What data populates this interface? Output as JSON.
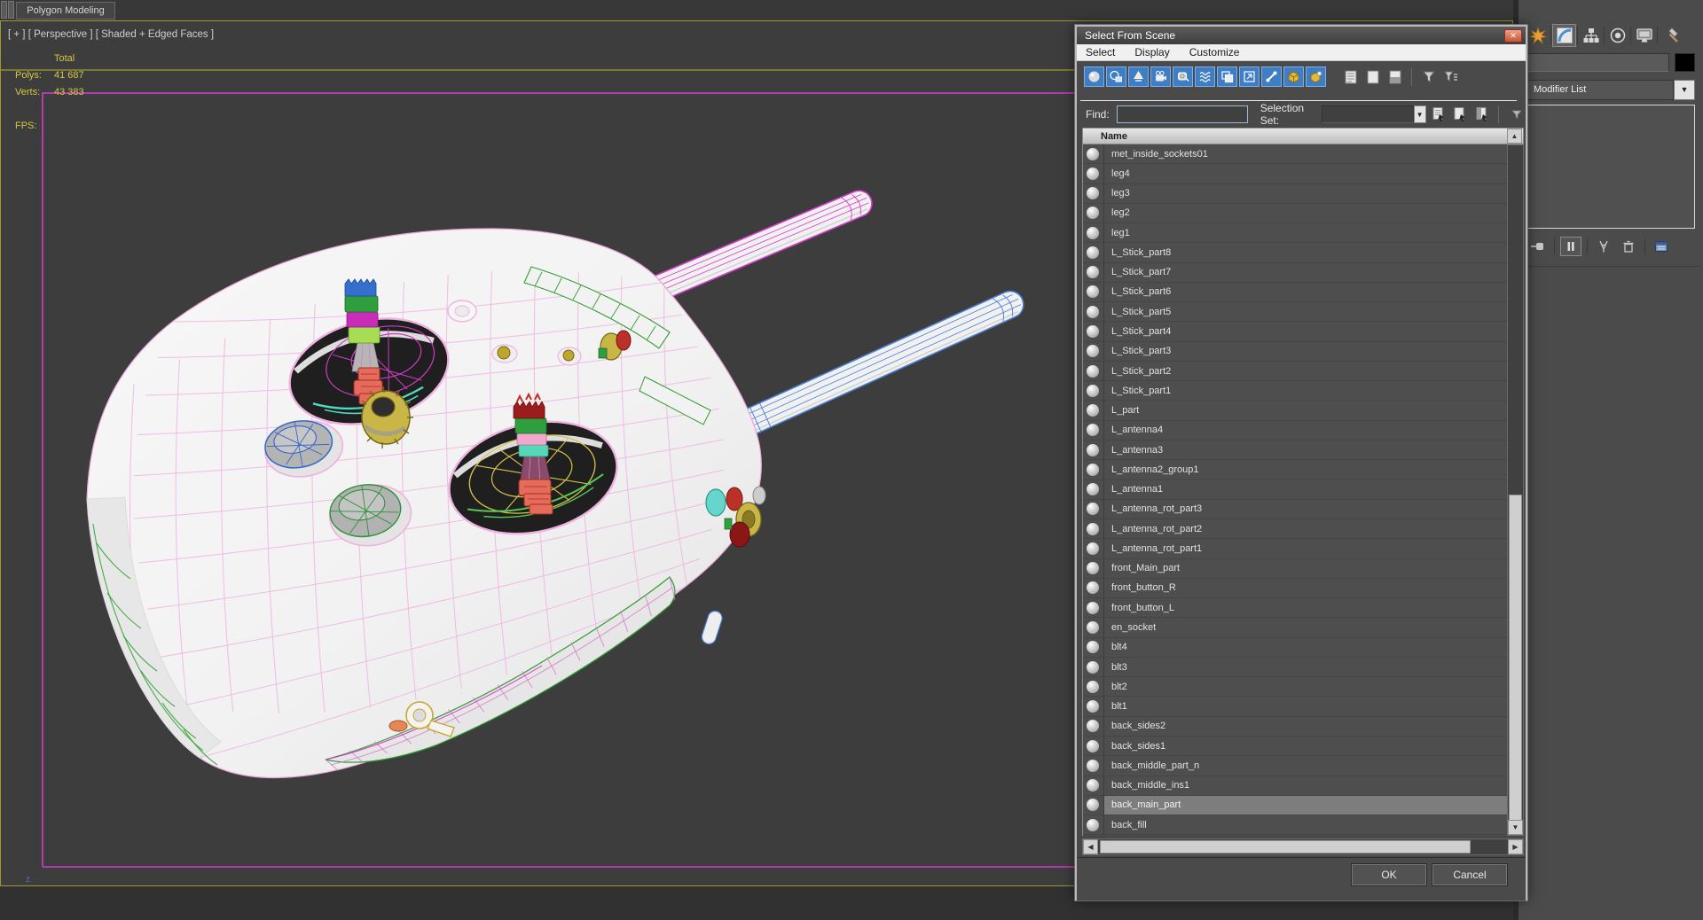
{
  "ribbon": {
    "tab_label": "Polygon Modeling"
  },
  "viewport": {
    "label": "[ + ] [ Perspective ] [ Shaded + Edged Faces ]",
    "stats": {
      "total_header": "Total",
      "polys_label": "Polys:",
      "polys_value": "41 687",
      "verts_label": "Verts:",
      "verts_value": "43 383",
      "fps_label": "FPS:"
    },
    "axis_label": "z",
    "colors": {
      "background": "#3d3d3d",
      "active_border": "#9a9a2e",
      "scene_line_olive": "#8f8f2e",
      "scene_line_magenta": "#d63bd0",
      "stats_text": "#d8c742",
      "wire_pink": "#f0b2e0",
      "wire_green": "#3aa43a",
      "wire_yellow": "#d9c44a",
      "wire_cyan": "#52d8c0",
      "antenna_top_wire": "#d23ec8",
      "antenna_bottom_wire": "#4a7fd4"
    }
  },
  "dialog": {
    "title": "Select From Scene",
    "menu": [
      "Select",
      "Display",
      "Customize"
    ],
    "toolbar_icons": [
      "display-geometry",
      "display-shapes",
      "display-lights",
      "display-cameras",
      "display-helpers",
      "display-space-warps",
      "display-groups",
      "display-xrefs",
      "display-bones",
      "display-containers",
      "display-container-objects",
      "display-children",
      "display-influences",
      "display-dependents",
      "selection-filter",
      "customize-filter"
    ],
    "find_label": "Find:",
    "find_value": "",
    "selection_set_label": "Selection Set:",
    "selection_set_value": "",
    "row_buttons": [
      "select-all",
      "select-none",
      "select-invert"
    ],
    "list_header": "Name",
    "items": [
      "met_inside_sockets01",
      "leg4",
      "leg3",
      "leg2",
      "leg1",
      "L_Stick_part8",
      "L_Stick_part7",
      "L_Stick_part6",
      "L_Stick_part5",
      "L_Stick_part4",
      "L_Stick_part3",
      "L_Stick_part2",
      "L_Stick_part1",
      "L_part",
      "L_antenna4",
      "L_antenna3",
      "L_antenna2_group1",
      "L_antenna1",
      "L_antenna_rot_part3",
      "L_antenna_rot_part2",
      "L_antenna_rot_part1",
      "front_Main_part",
      "front_button_R",
      "front_button_L",
      "en_socket",
      "blt4",
      "blt3",
      "blt2",
      "blt1",
      "back_sides2",
      "back_sides1",
      "back_middle_part_n",
      "back_middle_ins1",
      "back_main_part",
      "back_fill"
    ],
    "selected_item": "back_main_part",
    "ok_label": "OK",
    "cancel_label": "Cancel",
    "accent_blue": "#3f7ec4",
    "selection_grey": "#7d7d7d"
  },
  "panel": {
    "tabs": [
      "create",
      "modify",
      "hierarchy",
      "motion",
      "display",
      "utilities"
    ],
    "selected_tab": "modify",
    "object_name_value": "",
    "object_color": "#000000",
    "modifier_list_label": "Modifier List",
    "stack_tools": [
      "pin-stack",
      "show-end-result",
      "make-unique",
      "remove-modifier",
      "configure-modifier-sets"
    ]
  }
}
